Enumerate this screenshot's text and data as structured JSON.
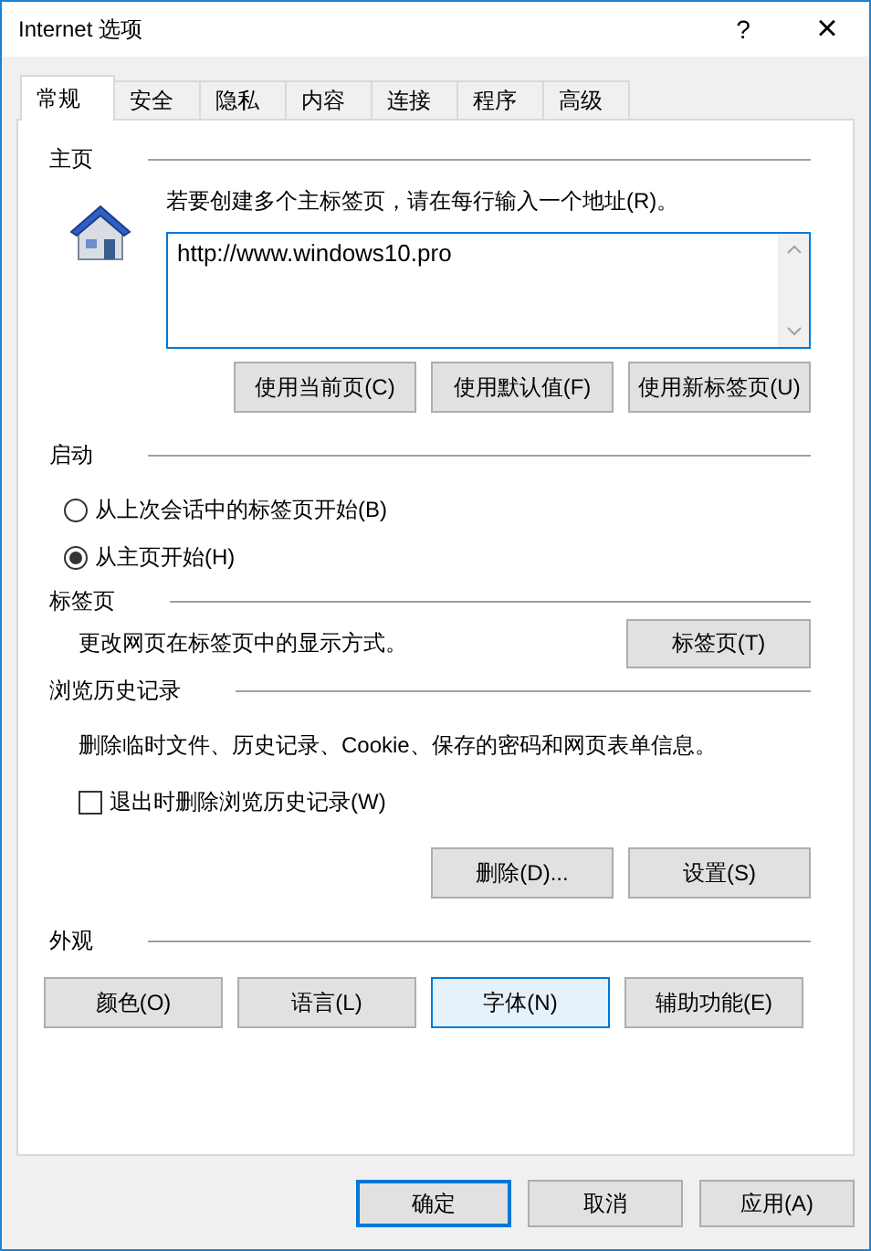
{
  "window": {
    "title": "Internet 选项",
    "help": "?",
    "close": "×"
  },
  "tabs": [
    {
      "label": "常规",
      "selected": true
    },
    {
      "label": "安全",
      "selected": false
    },
    {
      "label": "隐私",
      "selected": false
    },
    {
      "label": "内容",
      "selected": false
    },
    {
      "label": "连接",
      "selected": false
    },
    {
      "label": "程序",
      "selected": false
    },
    {
      "label": "高级",
      "selected": false
    }
  ],
  "home_page": {
    "heading": "主页",
    "instruction": "若要创建多个主标签页，请在每行输入一个地址(R)。",
    "address": "http://www.windows10.pro",
    "buttons": [
      {
        "label": "使用当前页(C)",
        "highlighted": false
      },
      {
        "label": "使用默认值(F)",
        "highlighted": false
      },
      {
        "label": "使用新标签页(U)",
        "highlighted": false
      }
    ]
  },
  "startup": {
    "heading": "启动",
    "options": [
      {
        "label": "从上次会话中的标签页开始(B)",
        "selected": false
      },
      {
        "label": "从主页开始(H)",
        "selected": true
      }
    ]
  },
  "tabs_section": {
    "heading": "标签页",
    "description": "更改网页在标签页中的显示方式。",
    "button": "标签页(T)"
  },
  "history": {
    "heading": "浏览历史记录",
    "description": "删除临时文件、历史记录、Cookie、保存的密码和网页表单信息。",
    "delete_on_exit": {
      "label": "退出时删除浏览历史记录(W)",
      "checked": false
    },
    "buttons": [
      {
        "label": "删除(D)...",
        "highlighted": false
      },
      {
        "label": "设置(S)",
        "highlighted": false
      }
    ]
  },
  "appearance": {
    "heading": "外观",
    "buttons": [
      {
        "label": "颜色(O)",
        "highlighted": false
      },
      {
        "label": "语言(L)",
        "highlighted": false
      },
      {
        "label": "字体(N)",
        "highlighted": true
      },
      {
        "label": "辅助功能(E)",
        "highlighted": false
      }
    ]
  },
  "footer_buttons": [
    {
      "label": "确定",
      "default": true
    },
    {
      "label": "取消",
      "default": false
    },
    {
      "label": "应用(A)",
      "default": false
    }
  ]
}
